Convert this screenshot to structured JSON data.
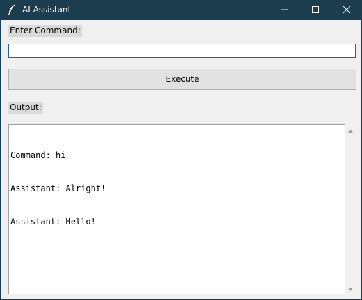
{
  "window": {
    "title": "AI Assistant",
    "icon": "feather-icon"
  },
  "titlebar_buttons": [
    "minimize-icon",
    "maximize-icon",
    "close-icon"
  ],
  "command": {
    "label": "Enter Command:",
    "value": "",
    "placeholder": ""
  },
  "execute_button": {
    "label": "Execute"
  },
  "output": {
    "label": "Output:",
    "lines": [
      "Command: hi",
      "Assistant: Alright!",
      "Assistant: Hello!"
    ]
  },
  "colors": {
    "titlebar": "#1c3d4e",
    "background": "#f0f0f0",
    "input_border": "#2e5f86"
  }
}
